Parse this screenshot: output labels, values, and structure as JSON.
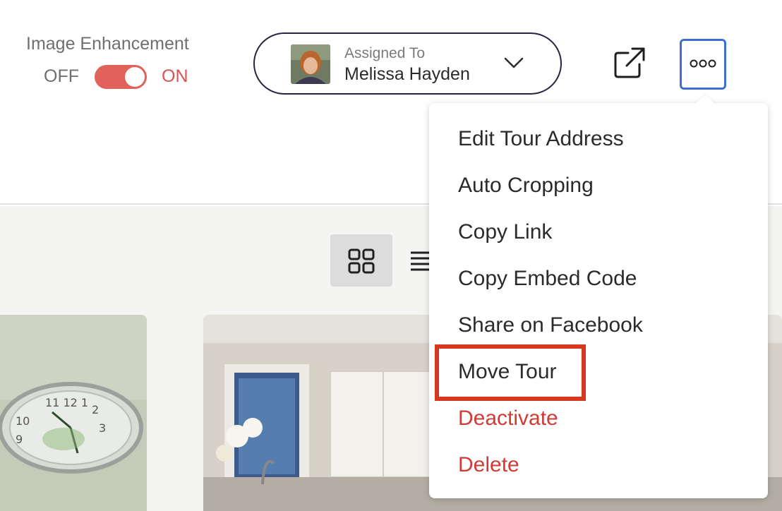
{
  "image_enhancement": {
    "title": "Image Enhancement",
    "off_label": "OFF",
    "on_label": "ON",
    "state": "on",
    "accent_color": "#e0625a"
  },
  "assignee": {
    "label": "Assigned To",
    "name": "Melissa Hayden"
  },
  "toolbar": {
    "external_link_icon": "external-link-icon",
    "more_icon": "more-horizontal-icon",
    "more_border_color": "#3b6fd1"
  },
  "view_toggle": {
    "grid_icon": "grid-icon",
    "list_icon": "list-icon",
    "active": "grid"
  },
  "menu": {
    "items": [
      {
        "label": "Edit Tour Address"
      },
      {
        "label": "Auto Cropping"
      },
      {
        "label": "Copy Link"
      },
      {
        "label": "Copy Embed Code"
      },
      {
        "label": "Share on Facebook"
      },
      {
        "label": "Move Tour"
      },
      {
        "label": "Deactivate"
      },
      {
        "label": "Delete"
      }
    ],
    "danger_color": "#d23a35",
    "highlighted_item": "Move Tour",
    "highlight_color": "#d7361f"
  }
}
